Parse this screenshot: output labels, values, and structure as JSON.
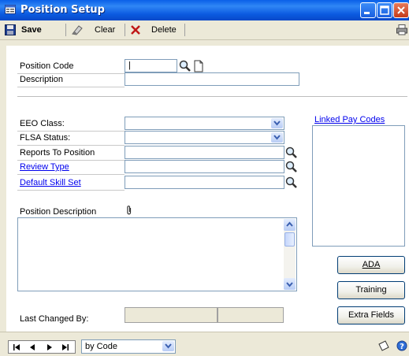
{
  "window": {
    "title": "Position Setup",
    "accent": "#0A5FE8"
  },
  "toolbar": {
    "save_label": "Save",
    "clear_label": "Clear",
    "delete_label": "Delete"
  },
  "form": {
    "position_code": {
      "label": "Position Code",
      "value": "|"
    },
    "description": {
      "label": "Description",
      "value": ""
    },
    "eeo_class": {
      "label": "EEO Class:",
      "value": ""
    },
    "flsa_status": {
      "label": "FLSA Status:",
      "value": ""
    },
    "reports_to": {
      "label": "Reports To Position",
      "value": ""
    },
    "review_type": {
      "label": "Review Type",
      "value": ""
    },
    "default_skill_set": {
      "label": "Default Skill Set",
      "value": ""
    },
    "position_description": {
      "label": "Position Description",
      "value": ""
    },
    "last_changed_by": {
      "label": "Last Changed By:"
    },
    "linked_pay_codes": {
      "label": "Linked Pay Codes"
    }
  },
  "buttons": {
    "ada": "ADA",
    "training": "Training",
    "extra_fields": "Extra Fields"
  },
  "statusbar": {
    "sort_by": "by Code"
  },
  "icons": [
    "window-icon",
    "save-icon",
    "clear-icon",
    "delete-icon",
    "printer-icon",
    "lookup-icon",
    "new-note-icon",
    "chevron-down-icon",
    "paperclip-icon",
    "first-record-icon",
    "previous-record-icon",
    "next-record-icon",
    "last-record-icon",
    "note-icon",
    "help-icon"
  ]
}
